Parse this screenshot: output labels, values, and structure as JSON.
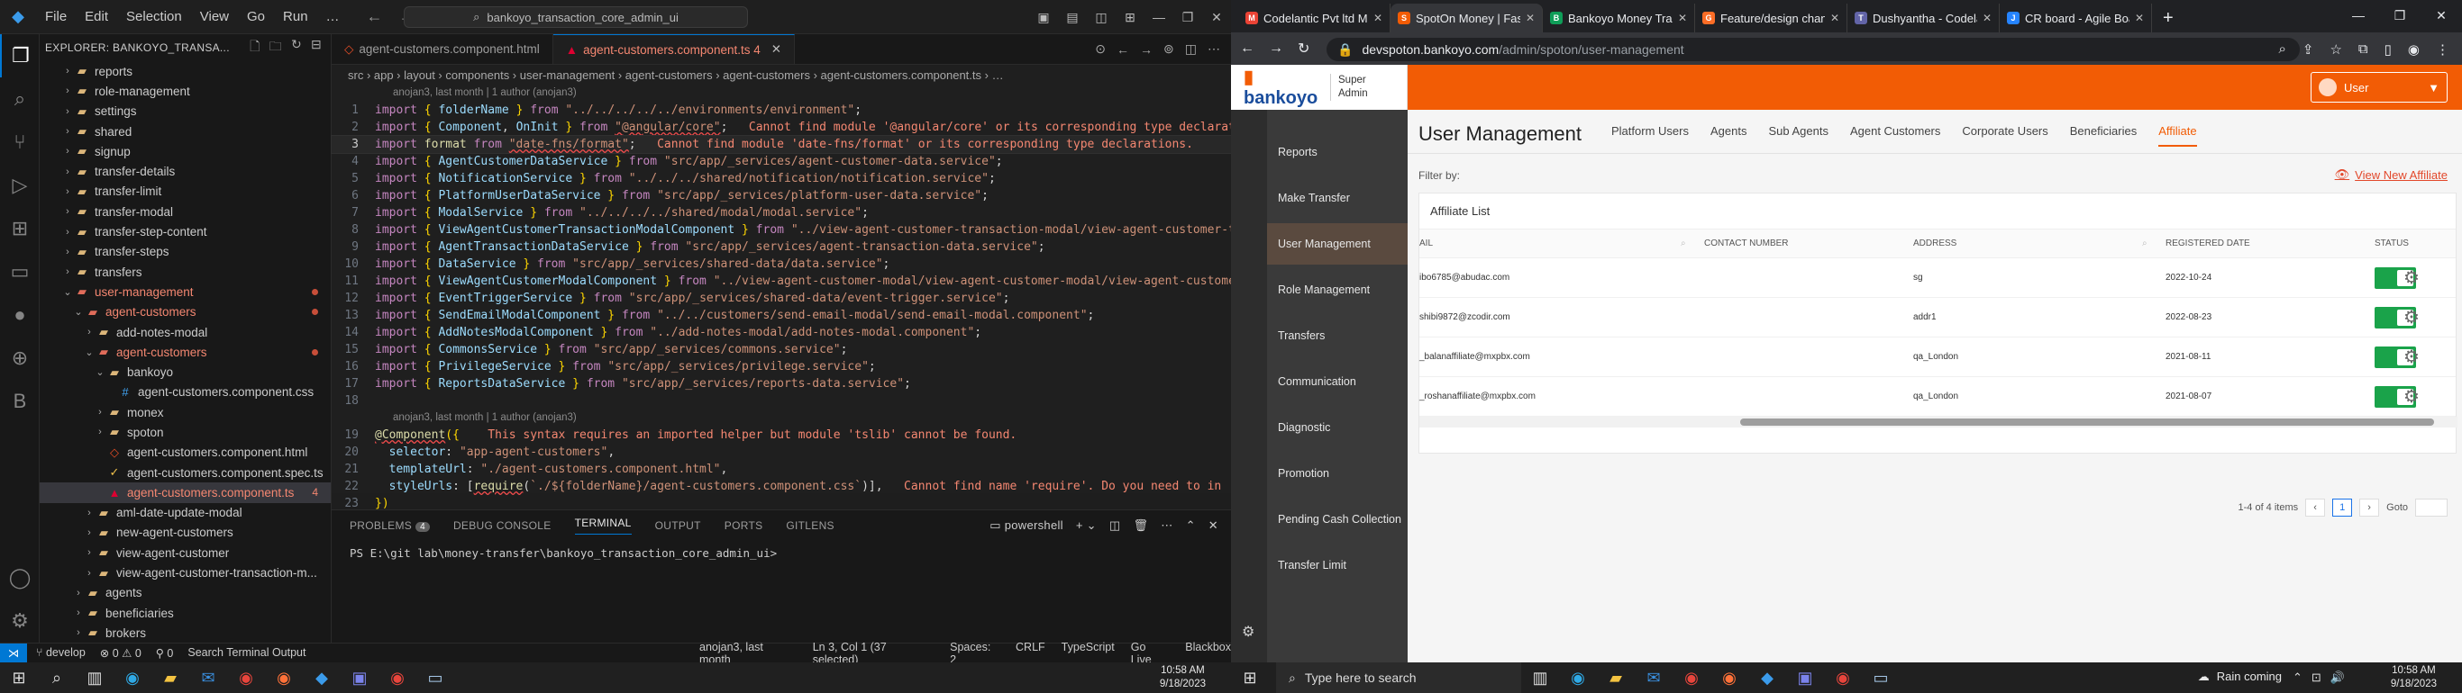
{
  "vscode": {
    "menu": [
      "File",
      "Edit",
      "Selection",
      "View",
      "Go",
      "Run",
      "…"
    ],
    "search": "bankoyo_transaction_core_admin_ui",
    "explorer_title": "EXPLORER: BANKOYO_TRANSA...",
    "tree": [
      {
        "label": "reports",
        "depth": 2,
        "kind": "folder",
        "chev": "›"
      },
      {
        "label": "role-management",
        "depth": 2,
        "kind": "folder",
        "chev": "›"
      },
      {
        "label": "settings",
        "depth": 2,
        "kind": "folder",
        "chev": "›"
      },
      {
        "label": "shared",
        "depth": 2,
        "kind": "folder",
        "chev": "›"
      },
      {
        "label": "signup",
        "depth": 2,
        "kind": "folder",
        "chev": "›"
      },
      {
        "label": "transfer-details",
        "depth": 2,
        "kind": "folder",
        "chev": "›"
      },
      {
        "label": "transfer-limit",
        "depth": 2,
        "kind": "folder",
        "chev": "›"
      },
      {
        "label": "transfer-modal",
        "depth": 2,
        "kind": "folder",
        "chev": "›"
      },
      {
        "label": "transfer-step-content",
        "depth": 2,
        "kind": "folder",
        "chev": "›"
      },
      {
        "label": "transfer-steps",
        "depth": 2,
        "kind": "folder",
        "chev": "›"
      },
      {
        "label": "transfers",
        "depth": 2,
        "kind": "folder",
        "chev": "›"
      },
      {
        "label": "user-management",
        "depth": 2,
        "kind": "folder-red",
        "chev": "⌄",
        "red": true,
        "dot": true
      },
      {
        "label": "agent-customers",
        "depth": 3,
        "kind": "folder-red",
        "chev": "⌄",
        "red": true,
        "dot": true
      },
      {
        "label": "add-notes-modal",
        "depth": 4,
        "kind": "folder",
        "chev": "›"
      },
      {
        "label": "agent-customers",
        "depth": 4,
        "kind": "folder-red",
        "chev": "⌄",
        "red": true,
        "dot": true
      },
      {
        "label": "bankoyo",
        "depth": 5,
        "kind": "folder",
        "chev": "⌄"
      },
      {
        "label": "agent-customers.component.css",
        "depth": 6,
        "kind": "css",
        "chev": ""
      },
      {
        "label": "monex",
        "depth": 5,
        "kind": "folder",
        "chev": "›"
      },
      {
        "label": "spoton",
        "depth": 5,
        "kind": "folder",
        "chev": "›"
      },
      {
        "label": "agent-customers.component.html",
        "depth": 5,
        "kind": "html",
        "chev": ""
      },
      {
        "label": "agent-customers.component.spec.ts",
        "depth": 5,
        "kind": "spec",
        "chev": ""
      },
      {
        "label": "agent-customers.component.ts",
        "depth": 5,
        "kind": "ts",
        "chev": "",
        "red": true,
        "selected": true,
        "badge": "4"
      },
      {
        "label": "aml-date-update-modal",
        "depth": 4,
        "kind": "folder",
        "chev": "›"
      },
      {
        "label": "new-agent-customers",
        "depth": 4,
        "kind": "folder",
        "chev": "›"
      },
      {
        "label": "view-agent-customer",
        "depth": 4,
        "kind": "folder",
        "chev": "›"
      },
      {
        "label": "view-agent-customer-transaction-m...",
        "depth": 4,
        "kind": "folder",
        "chev": "›"
      },
      {
        "label": "agents",
        "depth": 3,
        "kind": "folder",
        "chev": "›"
      },
      {
        "label": "beneficiaries",
        "depth": 3,
        "kind": "folder",
        "chev": "›"
      },
      {
        "label": "brokers",
        "depth": 3,
        "kind": "folder",
        "chev": "›"
      }
    ],
    "tabs": [
      {
        "label": "agent-customers.component.html",
        "active": false
      },
      {
        "label": "agent-customers.component.ts 4",
        "active": true
      }
    ],
    "breadcrumb": "src › app › layout › components › user-management › agent-customers › agent-customers › agent-customers.component.ts › …",
    "codelens1": "anojan3, last month | 1 author (anojan3)",
    "codelens2": "anojan3, last month | 1 author (anojan3)",
    "panel_tabs": [
      "PROBLEMS",
      "DEBUG CONSOLE",
      "TERMINAL",
      "OUTPUT",
      "PORTS",
      "GITLENS"
    ],
    "problems_count": "4",
    "terminal_shell": "powershell",
    "terminal_prompt": "PS E:\\git lab\\money-transfer\\bankoyo_transaction_core_admin_ui>",
    "status": {
      "branch": "develop",
      "problems": "⊗ 0 ⚠ 0",
      "ports": "⚲ 0",
      "search": "Search Terminal Output",
      "blame": "anojan3, last month",
      "position": "Ln 3, Col 1 (37 selected)",
      "spaces": "Spaces: 2",
      "eol": "CRLF",
      "lang": "TypeScript",
      "golive": "Go Live",
      "blackbox": "Blackbox"
    }
  },
  "chrome": {
    "tabs": [
      {
        "label": "Codelantic Pvt ltd Ma",
        "fav": "M",
        "color": "#ea4335"
      },
      {
        "label": "SpotOn Money | Fast",
        "fav": "S",
        "color": "#f25c05",
        "active": true
      },
      {
        "label": "Bankoyo Money Trans",
        "fav": "B",
        "color": "#0f9d58"
      },
      {
        "label": "Feature/design chang",
        "fav": "G",
        "color": "#fc6d26"
      },
      {
        "label": "Dushyantha - Codelan",
        "fav": "T",
        "color": "#6264a7"
      },
      {
        "label": "CR board - Agile Boa",
        "fav": "J",
        "color": "#2684ff"
      }
    ],
    "url_domain": "devspoton.bankoyo.com",
    "url_path": "/admin/spoton/user-management"
  },
  "app": {
    "brand": "bankoyo",
    "brand_sub1": "Super",
    "brand_sub2": "Admin",
    "user": "User",
    "sidebar": [
      "Reports",
      "Make Transfer",
      "User Management",
      "Role Management",
      "Transfers",
      "Communication",
      "Diagnostic",
      "Promotion",
      "Pending Cash Collection",
      "Transfer Limit"
    ],
    "sidebar_active": "User Management",
    "page_title": "User Management",
    "tabs": [
      "Platform Users",
      "Agents",
      "Sub Agents",
      "Agent Customers",
      "Corporate Users",
      "Beneficiaries",
      "Affiliate"
    ],
    "tab_active": "Affiliate",
    "filter_label": "Filter by:",
    "view_new": "View New Affiliate",
    "list_title": "Affiliate List",
    "columns": [
      "AIL",
      "CONTACT NUMBER",
      "ADDRESS",
      "REGISTERED DATE",
      "STATUS"
    ],
    "rows": [
      {
        "email": "ibo6785@abudac.com",
        "contact": "",
        "address": "sg",
        "date": "2022-10-24",
        "status": true
      },
      {
        "email": "shibi9872@zcodir.com",
        "contact": "",
        "address": "addr1",
        "date": "2022-08-23",
        "status": true
      },
      {
        "email": "_balanaffiliate@mxpbx.com",
        "contact": "",
        "address": "qa_London",
        "date": "2021-08-11",
        "status": true
      },
      {
        "email": "_roshanaffiliate@mxpbx.com",
        "contact": "",
        "address": "qa_London",
        "date": "2021-08-07",
        "status": true
      }
    ],
    "pager_summary": "1-4 of 4 items",
    "pager_page": "1",
    "pager_goto": "Goto"
  },
  "taskbar": {
    "left_time": "10:58 AM",
    "left_date": "9/18/2023",
    "search_placeholder": "Type here to search",
    "weather": "Rain coming",
    "right_time": "10:58 AM",
    "right_date": "9/18/2023"
  }
}
